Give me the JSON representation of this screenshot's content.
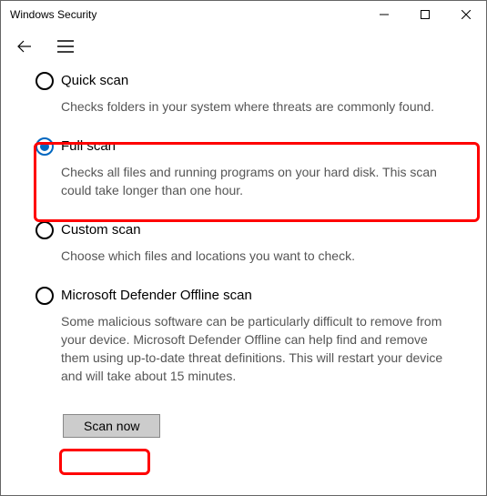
{
  "window": {
    "title": "Windows Security"
  },
  "scan": {
    "options": [
      {
        "title": "Quick scan",
        "desc": "Checks folders in your system where threats are commonly found.",
        "selected": false
      },
      {
        "title": "Full scan",
        "desc": "Checks all files and running programs on your hard disk. This scan could take longer than one hour.",
        "selected": true
      },
      {
        "title": "Custom scan",
        "desc": "Choose which files and locations you want to check.",
        "selected": false
      },
      {
        "title": "Microsoft Defender Offline scan",
        "desc": "Some malicious software can be particularly difficult to remove from your device. Microsoft Defender Offline can help find and remove them using up-to-date threat definitions. This will restart your device and will take about 15 minutes.",
        "selected": false
      }
    ],
    "button_label": "Scan now"
  },
  "colors": {
    "accent": "#0067c0",
    "highlight": "#ff0000"
  }
}
